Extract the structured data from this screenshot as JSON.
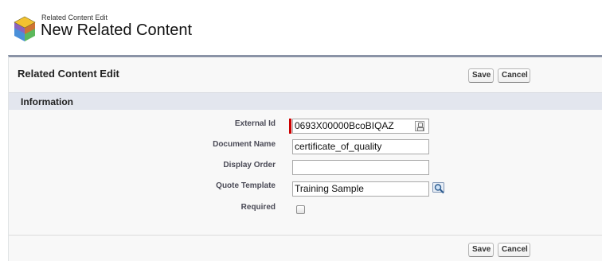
{
  "header": {
    "subtitle": "Related Content Edit",
    "title": "New Related Content"
  },
  "panel": {
    "title": "Related Content Edit",
    "save_label": "Save",
    "cancel_label": "Cancel",
    "section_title": "Information"
  },
  "fields": {
    "external_id": {
      "label": "External Id",
      "value": "0693X00000BcoBIQAZ",
      "required": true
    },
    "document_name": {
      "label": "Document Name",
      "value": "certificate_of_quality"
    },
    "display_order": {
      "label": "Display Order",
      "value": ""
    },
    "quote_template": {
      "label": "Quote Template",
      "value": "Training Sample"
    },
    "required": {
      "label": "Required",
      "checked": false
    }
  },
  "icons": {
    "header": "related-content-cube-icon",
    "external_id_picker": "picker-icon",
    "lookup": "lookup-magnifier-icon"
  },
  "colors": {
    "panel_top_border": "#8a93a6",
    "section_bar": "#e3e6ee",
    "required_marker": "#cc0000"
  }
}
